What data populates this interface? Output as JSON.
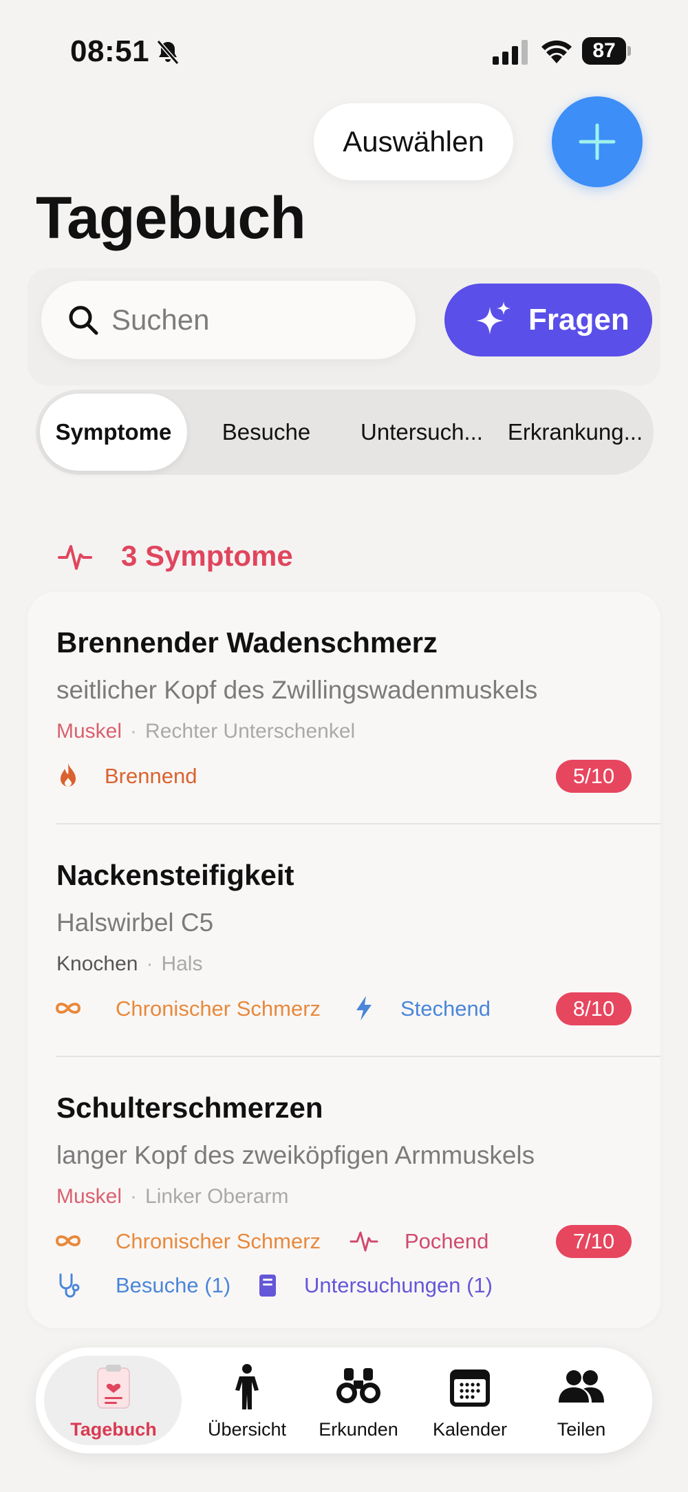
{
  "status_bar": {
    "time": "08:51",
    "battery": "87",
    "icons": [
      "bell-slash-icon",
      "signal-icon",
      "wifi-icon",
      "battery-icon"
    ]
  },
  "header": {
    "select_label": "Auswählen",
    "add_icon": "plus-icon",
    "title": "Tagebuch"
  },
  "search": {
    "placeholder": "Suchen",
    "value": "",
    "icon": "search-icon"
  },
  "ask": {
    "label": "Fragen",
    "icon": "sparkles-icon"
  },
  "segments": [
    {
      "label": "Symptome",
      "active": true
    },
    {
      "label": "Besuche",
      "active": false
    },
    {
      "label": "Untersuch...",
      "active": false
    },
    {
      "label": "Erkrankung...",
      "active": false
    }
  ],
  "section": {
    "title": "3 Symptome",
    "icon": "heartbeat-icon"
  },
  "cards": [
    {
      "title": "Brennender Wadenschmerz",
      "subtitle": "seitlicher Kopf des Zwillingswadenmuskels",
      "category": "Muskel",
      "location": "Rechter Unterschenkel",
      "tags": [
        {
          "label": "Brennend",
          "icon": "flame-icon"
        }
      ],
      "severity": "5/10"
    },
    {
      "title": "Nackensteifigkeit",
      "subtitle": "Halswirbel C5",
      "category": "Knochen",
      "location": "Hals",
      "tags": [
        {
          "label": "Chronischer Schmerz",
          "icon": "infinity-icon"
        },
        {
          "label": "Stechend",
          "icon": "lightning-icon"
        }
      ],
      "severity": "8/10"
    },
    {
      "title": "Schulterschmerzen",
      "subtitle": "langer Kopf des zweiköpfigen Armmuskels",
      "category": "Muskel",
      "location": "Linker Oberarm",
      "tags": [
        {
          "label": "Chronischer Schmerz",
          "icon": "infinity-icon"
        },
        {
          "label": "Pochend",
          "icon": "pulse-icon"
        }
      ],
      "links": [
        {
          "label": "Besuche (1)",
          "icon": "stethoscope-icon"
        },
        {
          "label": "Untersuchungen (1)",
          "icon": "document-icon"
        }
      ],
      "severity": "7/10"
    }
  ],
  "tabs": [
    {
      "label": "Tagebuch",
      "icon": "clipboard-heart-icon",
      "active": true
    },
    {
      "label": "Übersicht",
      "icon": "person-icon",
      "active": false
    },
    {
      "label": "Erkunden",
      "icon": "binoculars-icon",
      "active": false
    },
    {
      "label": "Kalender",
      "icon": "calendar-icon",
      "active": false
    },
    {
      "label": "Teilen",
      "icon": "people-icon",
      "active": false
    }
  ],
  "colors": {
    "accent_blue": "#3d8ef7",
    "accent_purple": "#5a4fe8",
    "symptom_red": "#e0455d",
    "category_muscle": "#d9606e",
    "tag_orange": "#e8893c",
    "tag_flame": "#d9622e",
    "tag_blue": "#4a86d9",
    "tag_pink": "#d04a6e",
    "link_purple": "#6457d8"
  }
}
